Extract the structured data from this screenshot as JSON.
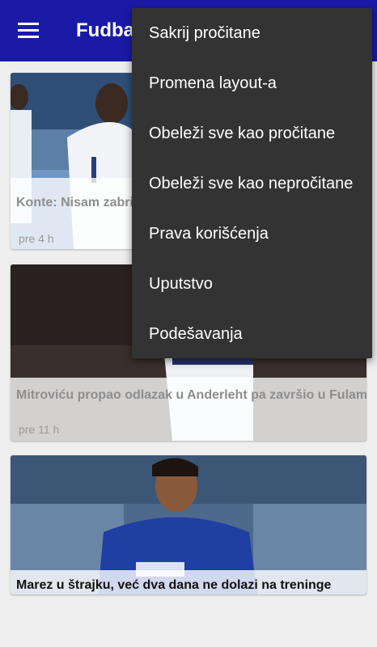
{
  "appbar": {
    "title": "Fudba",
    "menu_icon": "hamburger-menu-icon",
    "color": "#1a1aa6"
  },
  "articles": [
    {
      "title": "Konte: Nisam zabrin",
      "time": "pre 4 h",
      "read": true
    },
    {
      "title": "Mitroviću propao odlazak u Anderleht pa završio u Fulamu",
      "time": "pre 11 h",
      "read": true
    },
    {
      "title": "Marez u štrajku, već dva dana ne dolazi na treninge",
      "time": "",
      "read": false
    }
  ],
  "overflow_menu": {
    "items": [
      "Sakrij pročitane",
      "Promena layout-a",
      "Obeleži sve kao pročitane",
      "Obeleži sve kao nepročitane",
      "Prava korišćenja",
      "Uputstvo",
      "Podešavanja"
    ],
    "background": "#333333"
  }
}
